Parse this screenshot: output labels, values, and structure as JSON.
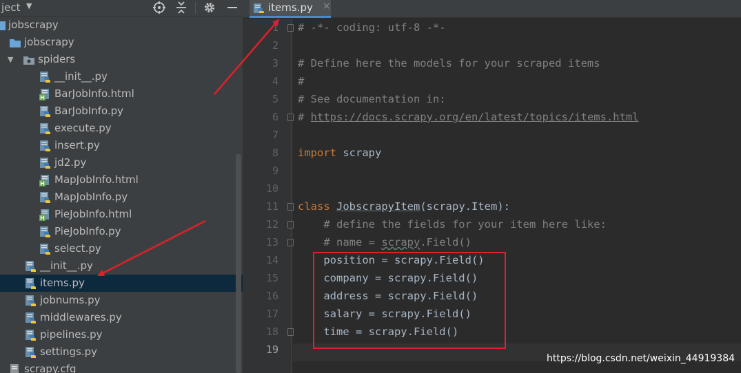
{
  "sidebar": {
    "title": "ject",
    "caret": "▼",
    "tree": [
      {
        "label": "jobscrapy",
        "kind": "folder-root",
        "depth": 0,
        "arrow": ""
      },
      {
        "label": "jobscrapy",
        "kind": "folder",
        "depth": 1,
        "arrow": ""
      },
      {
        "label": "spiders",
        "kind": "folder-pkg",
        "depth": 1,
        "arrow": "▼"
      },
      {
        "label": "__init__.py",
        "kind": "py",
        "depth": 3,
        "arrow": ""
      },
      {
        "label": "BarJobInfo.html",
        "kind": "html",
        "depth": 3,
        "arrow": ""
      },
      {
        "label": "BarJobInfo.py",
        "kind": "py",
        "depth": 3,
        "arrow": ""
      },
      {
        "label": "execute.py",
        "kind": "py",
        "depth": 3,
        "arrow": ""
      },
      {
        "label": "insert.py",
        "kind": "py",
        "depth": 3,
        "arrow": ""
      },
      {
        "label": "jd2.py",
        "kind": "py",
        "depth": 3,
        "arrow": ""
      },
      {
        "label": "MapJobInfo.html",
        "kind": "html",
        "depth": 3,
        "arrow": ""
      },
      {
        "label": "MapJobInfo.py",
        "kind": "py",
        "depth": 3,
        "arrow": ""
      },
      {
        "label": "PieJobInfo.html",
        "kind": "html",
        "depth": 3,
        "arrow": ""
      },
      {
        "label": "PieJobInfo.py",
        "kind": "py",
        "depth": 3,
        "arrow": ""
      },
      {
        "label": "select.py",
        "kind": "py",
        "depth": 3,
        "arrow": ""
      },
      {
        "label": "__init__.py",
        "kind": "py",
        "depth": 2,
        "arrow": ""
      },
      {
        "label": "items.py",
        "kind": "py",
        "depth": 2,
        "arrow": "",
        "selected": true
      },
      {
        "label": "jobnums.py",
        "kind": "py",
        "depth": 2,
        "arrow": ""
      },
      {
        "label": "middlewares.py",
        "kind": "py",
        "depth": 2,
        "arrow": ""
      },
      {
        "label": "pipelines.py",
        "kind": "py",
        "depth": 2,
        "arrow": ""
      },
      {
        "label": "settings.py",
        "kind": "py",
        "depth": 2,
        "arrow": ""
      },
      {
        "label": "scrapy.cfg",
        "kind": "cfg",
        "depth": 1,
        "arrow": ""
      }
    ]
  },
  "editor": {
    "tab": {
      "label": "items.py",
      "close": "×"
    },
    "current_line": 19,
    "lines": [
      {
        "n": "1",
        "tokens": [
          {
            "t": "# -*- coding: utf-8 -*-",
            "c": "c"
          }
        ],
        "fold": true
      },
      {
        "n": "2",
        "tokens": []
      },
      {
        "n": "3",
        "tokens": [
          {
            "t": "# Define here the models for your scraped items",
            "c": "c"
          }
        ]
      },
      {
        "n": "4",
        "tokens": [
          {
            "t": "#",
            "c": "c"
          }
        ]
      },
      {
        "n": "5",
        "tokens": [
          {
            "t": "# See documentation in:",
            "c": "c"
          }
        ]
      },
      {
        "n": "6",
        "tokens": [
          {
            "t": "# ",
            "c": "c"
          },
          {
            "t": "https://docs.scrapy.org/en/latest/topics/items.html",
            "c": "url"
          }
        ],
        "fold": true
      },
      {
        "n": "7",
        "tokens": []
      },
      {
        "n": "8",
        "tokens": [
          {
            "t": "import",
            "c": "k"
          },
          {
            "t": " scrapy",
            "c": ""
          }
        ]
      },
      {
        "n": "9",
        "tokens": []
      },
      {
        "n": "10",
        "tokens": []
      },
      {
        "n": "11",
        "tokens": [
          {
            "t": "class",
            "c": "k"
          },
          {
            "t": " ",
            "c": ""
          },
          {
            "t": "JobscrapyItem",
            "c": "cls"
          },
          {
            "t": "(scrapy.Item):",
            "c": ""
          }
        ],
        "fold": true
      },
      {
        "n": "12",
        "tokens": [
          {
            "t": "    # define the fields for your item here like:",
            "c": "c"
          }
        ],
        "fold": true
      },
      {
        "n": "13",
        "tokens": [
          {
            "t": "    # name = ",
            "c": "c"
          },
          {
            "t": "scrapy",
            "c": "c typo"
          },
          {
            "t": ".Field()",
            "c": "c"
          }
        ],
        "fold": true
      },
      {
        "n": "14",
        "tokens": [
          {
            "t": "    position = scrapy.Field()",
            "c": ""
          }
        ]
      },
      {
        "n": "15",
        "tokens": [
          {
            "t": "    company = scrapy.Field()",
            "c": ""
          }
        ]
      },
      {
        "n": "16",
        "tokens": [
          {
            "t": "    address = scrapy.Field()",
            "c": ""
          }
        ]
      },
      {
        "n": "17",
        "tokens": [
          {
            "t": "    salary = scrapy.Field()",
            "c": ""
          }
        ]
      },
      {
        "n": "18",
        "tokens": [
          {
            "t": "    time = scrapy.Field()",
            "c": ""
          }
        ],
        "fold": true
      },
      {
        "n": "19",
        "tokens": []
      }
    ]
  },
  "watermark": "https://blog.csdn.net/weixin_44919384",
  "colors": {
    "sidebar_bg": "#3c3f41",
    "editor_bg": "#2b2b2b",
    "selection": "#0d293e",
    "keyword": "#cc7832",
    "comment": "#808080",
    "annotation_red": "#e0202a"
  }
}
